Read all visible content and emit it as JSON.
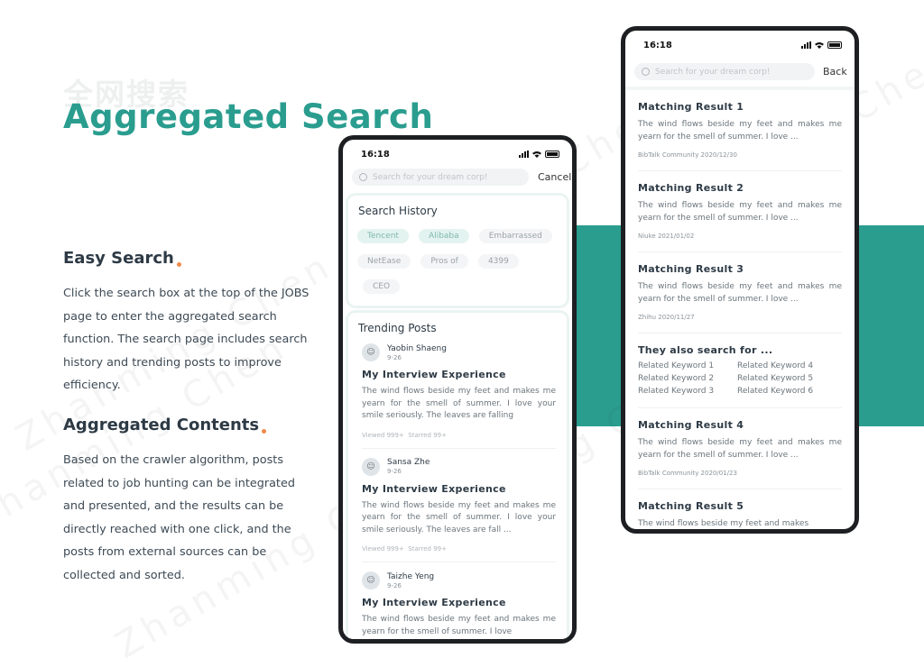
{
  "watermark": "Zhanming Chen",
  "page": {
    "subtitle_cn": "全网搜索",
    "title": "Aggregated Search",
    "sections": [
      {
        "title": "Easy Search",
        "body": "Click the search box at the top of the JOBS page to enter the aggregated search function. The search page includes search history and trending posts to improve efficiency."
      },
      {
        "title": "Aggregated Contents",
        "body": "Based on the crawler algorithm, posts related to job hunting can be integrated and presented, and the results can be directly reached with one click, and the posts from external sources can be collected and sorted."
      }
    ]
  },
  "colors": {
    "accent": "#2a9d8f",
    "dot": "#f08a4b",
    "phone_frame": "#1d1f22"
  },
  "phone_left": {
    "status_time": "16:18",
    "search_placeholder": "Search for your dream corp!",
    "cancel_label": "Cancel",
    "history_title": "Search History",
    "history_tags": [
      "Tencent",
      "Alibaba",
      "Embarrassed",
      "NetEase",
      "Pros of",
      "4399",
      "CEO"
    ],
    "trending_title": "Trending Posts",
    "posts": [
      {
        "author": "Yaobin Shaeng",
        "date": "9-26",
        "title": "My Interview Experience",
        "body": "The wind flows beside my feet and makes me yearn for the smell of summer. I love your smile seriously. The leaves are falling",
        "viewed": "Viewed 999+",
        "starred": "Starred 99+"
      },
      {
        "author": "Sansa Zhe",
        "date": "9-26",
        "title": "My Interview Experience",
        "body": "The wind flows beside my feet and makes me yearn for the smell of summer. I love your smile seriously. The leaves are fall ...",
        "viewed": "Viewed 999+",
        "starred": "Starred 99+"
      },
      {
        "author": "Taizhe Yeng",
        "date": "9-26",
        "title": "My Interview Experience",
        "body": "The wind flows beside my feet and makes me yearn for the smell of summer. I love",
        "viewed": "",
        "starred": ""
      }
    ]
  },
  "phone_right": {
    "status_time": "16:18",
    "search_placeholder": "Search for your dream corp!",
    "back_label": "Back",
    "results_a": [
      {
        "title": "Matching Result 1",
        "body": "The wind flows beside my feet and makes me yearn for the smell of summer. I love ...",
        "meta": "BibTalk Community  2020/12/30"
      },
      {
        "title": "Matching Result 2",
        "body": "The wind flows beside my feet and makes me yearn for the smell of summer. I love ...",
        "meta": "Niuke  2021/01/02"
      },
      {
        "title": "Matching Result 3",
        "body": "The wind flows beside my feet and makes me yearn for the smell of summer. I love ...",
        "meta": "Zhihu  2020/11/27"
      }
    ],
    "also_title": "They also search for ...",
    "keywords": [
      "Related Keyword 1",
      "Related Keyword 4",
      "Related Keyword 2",
      "Related Keyword 5",
      "Related Keyword 3",
      "Related Keyword 6"
    ],
    "results_b": [
      {
        "title": "Matching Result 4",
        "body": "The wind flows beside my feet and makes me yearn for the smell of summer. I love ...",
        "meta": "BibTalk Community 2020/01/23"
      },
      {
        "title": "Matching Result 5",
        "body": "The wind flows beside my feet and makes",
        "meta": ""
      }
    ]
  }
}
